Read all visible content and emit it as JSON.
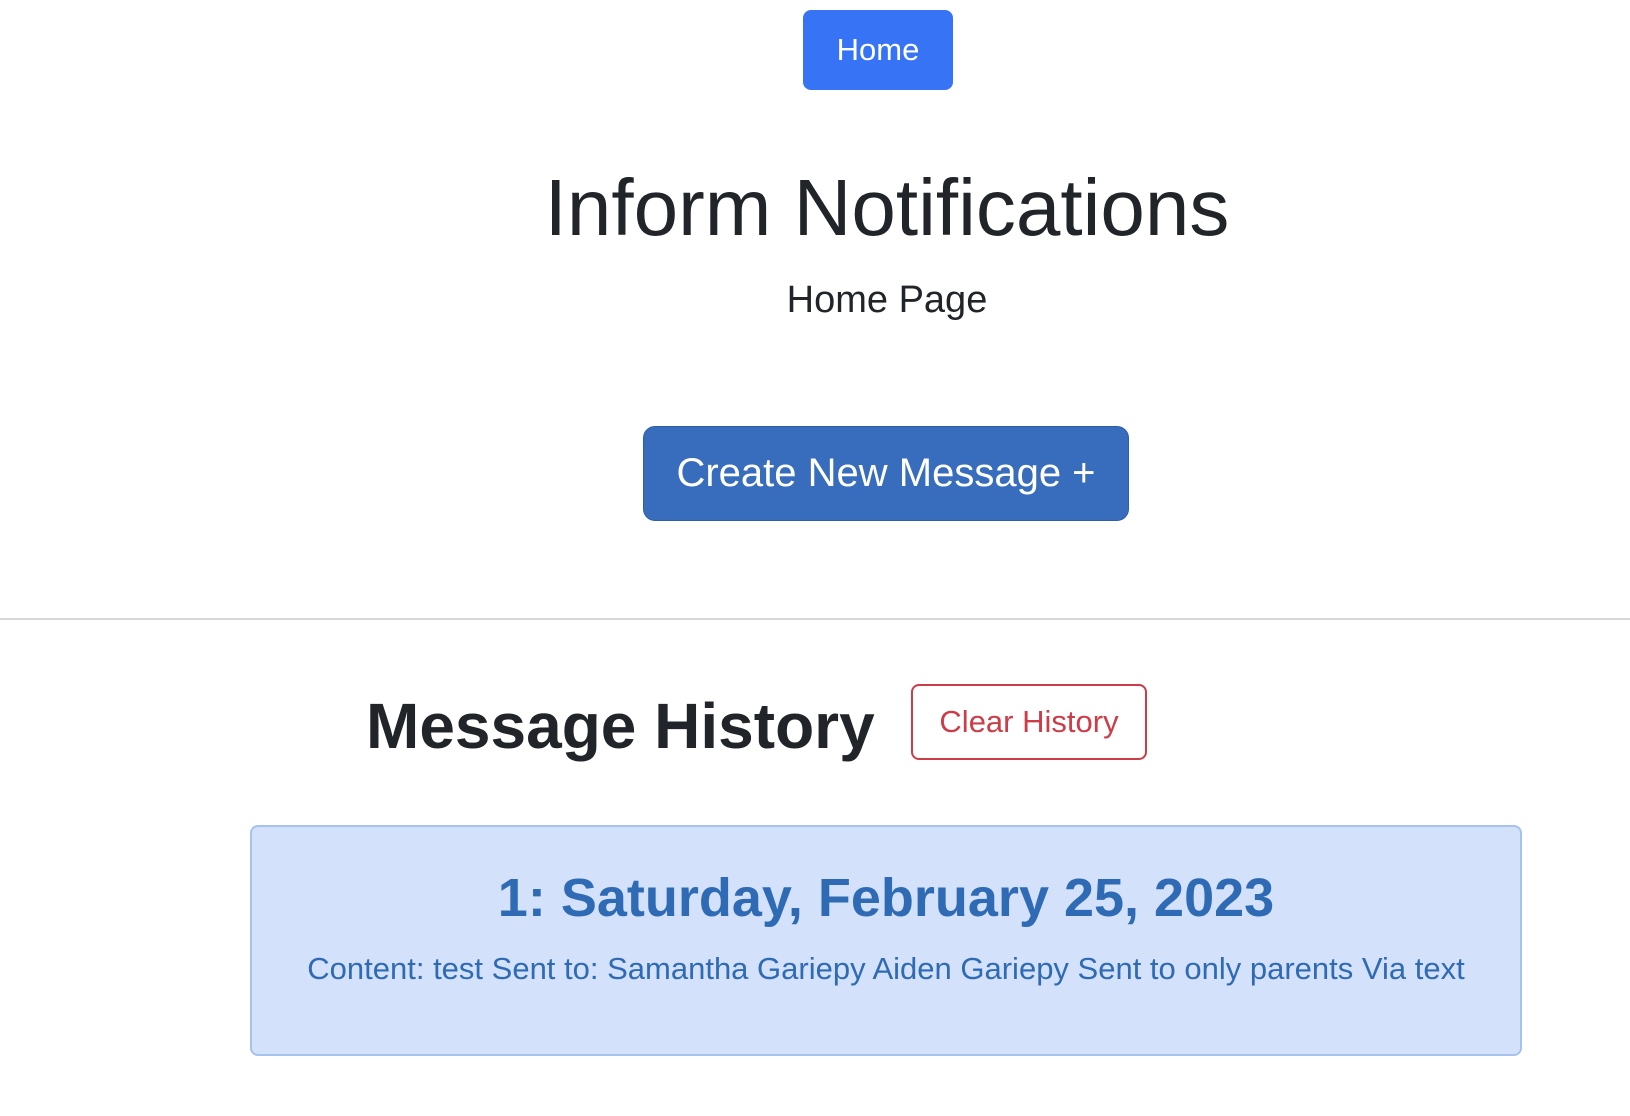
{
  "nav": {
    "home_label": "Home"
  },
  "header": {
    "title": "Inform Notifications",
    "subtitle": "Home Page"
  },
  "actions": {
    "create_label": "Create New Message +"
  },
  "history": {
    "heading": "Message History",
    "clear_label": "Clear History",
    "messages": [
      {
        "title": "1: Saturday, February 25, 2023",
        "body": "Content: test Sent to: Samantha Gariepy Aiden Gariepy Sent to only parents Via text"
      }
    ]
  },
  "colors": {
    "primary": "#3673f5",
    "create_button": "#386dbd",
    "danger": "#cc3d48",
    "card_background": "#d3e1fb",
    "card_text": "#2f6bb5",
    "text": "#212529"
  }
}
